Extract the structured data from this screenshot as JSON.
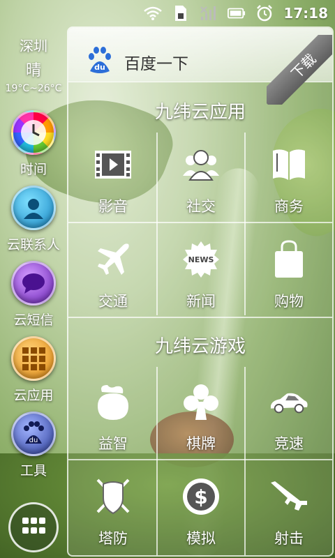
{
  "statusbar": {
    "time": "17:18",
    "icons": [
      "wifi-icon",
      "sd-card-icon",
      "signal-icon",
      "battery-icon",
      "alarm-icon"
    ]
  },
  "weather": {
    "city": "深圳",
    "condition": "晴",
    "temperature": "19°C~26°C"
  },
  "dock": [
    {
      "label": "时间",
      "icon": "clock-icon"
    },
    {
      "label": "云联系人",
      "icon": "contacts-icon"
    },
    {
      "label": "云短信",
      "icon": "sms-icon"
    },
    {
      "label": "云应用",
      "icon": "apps-icon"
    },
    {
      "label": "工具",
      "icon": "baidu-tools-icon"
    }
  ],
  "search": {
    "text": "百度一下",
    "download_ribbon": "下载"
  },
  "sections": {
    "apps": {
      "title": "九纬云应用",
      "items": [
        {
          "label": "影音",
          "icon": "film-icon"
        },
        {
          "label": "社交",
          "icon": "people-icon"
        },
        {
          "label": "商务",
          "icon": "book-icon"
        },
        {
          "label": "交通",
          "icon": "airplane-icon"
        },
        {
          "label": "新闻",
          "icon": "news-badge-icon"
        },
        {
          "label": "购物",
          "icon": "shopping-bag-icon"
        }
      ]
    },
    "games": {
      "title": "九纬云游戏",
      "items": [
        {
          "label": "益智",
          "icon": "puzzle-bag-icon"
        },
        {
          "label": "棋牌",
          "icon": "club-card-icon"
        },
        {
          "label": "竞速",
          "icon": "race-car-icon"
        },
        {
          "label": "塔防",
          "icon": "shield-swords-icon"
        },
        {
          "label": "模拟",
          "icon": "dollar-coin-icon"
        },
        {
          "label": "射击",
          "icon": "rifle-icon"
        }
      ]
    }
  },
  "news_badge_text": "NEWS"
}
